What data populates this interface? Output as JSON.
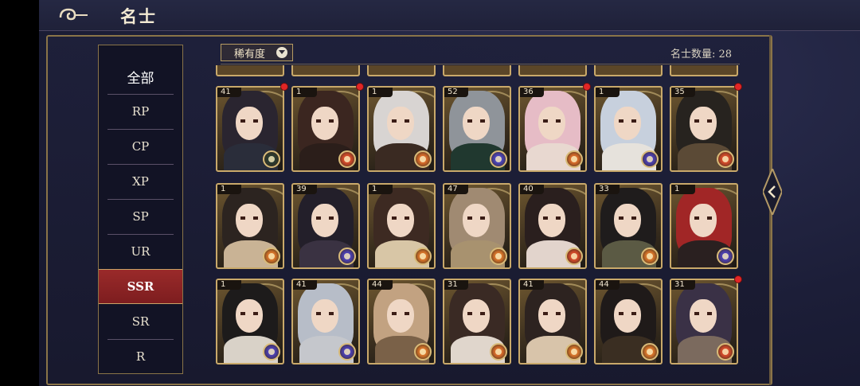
{
  "header": {
    "title": "名士"
  },
  "sidebar": {
    "items": [
      {
        "label": "全部"
      },
      {
        "label": "RP"
      },
      {
        "label": "CP"
      },
      {
        "label": "XP"
      },
      {
        "label": "SP"
      },
      {
        "label": "UR"
      },
      {
        "label": "SSR",
        "selected": true
      },
      {
        "label": "SR"
      },
      {
        "label": "R"
      }
    ]
  },
  "filter": {
    "label": "稀有度",
    "icon": "chevron-down-icon"
  },
  "count": {
    "text": "名士数量: 28"
  },
  "cards": [
    {
      "level": "41",
      "hair": "#2a2530",
      "body": "#2a2d3a",
      "badge": "#2b3a2f",
      "dot": true
    },
    {
      "level": "1",
      "hair": "#3b2620",
      "body": "#2b1e1a",
      "badge": "#d04a2a",
      "dot": true
    },
    {
      "level": "1",
      "hair": "#d8d4d2",
      "body": "#3a2a22",
      "badge": "#d46a2a",
      "dot": false
    },
    {
      "level": "52",
      "hair": "#8f949a",
      "body": "#20382f",
      "badge": "#4a43b8",
      "dot": false
    },
    {
      "level": "36",
      "hair": "#e6bcc6",
      "body": "#e8d8d0",
      "badge": "#d46a2a",
      "dot": true
    },
    {
      "level": "1",
      "hair": "#c7d0dd",
      "body": "#e6e2dc",
      "badge": "#4b3fae",
      "dot": false
    },
    {
      "level": "35",
      "hair": "#27231f",
      "body": "#5b4a36",
      "badge": "#d04a2a",
      "dot": true
    },
    {
      "level": "1",
      "hair": "#2c2420",
      "body": "#c9b395",
      "badge": "#d4732a",
      "dot": false
    },
    {
      "level": "39",
      "hair": "#231f2a",
      "body": "#3a3242",
      "badge": "#4b3fae",
      "dot": false
    },
    {
      "level": "1",
      "hair": "#3d2a22",
      "body": "#d8c6a6",
      "badge": "#d4732a",
      "dot": false
    },
    {
      "level": "47",
      "hair": "#a08a72",
      "body": "#a8926f",
      "badge": "#d4732a",
      "dot": false
    },
    {
      "level": "40",
      "hair": "#2a1f1e",
      "body": "#e2d4cc",
      "badge": "#d04a2a",
      "dot": false
    },
    {
      "level": "33",
      "hair": "#1f1c1c",
      "body": "#5b5a44",
      "badge": "#d4732a",
      "dot": false
    },
    {
      "level": "1",
      "hair": "#a12626",
      "body": "#2a2020",
      "badge": "#4b3fae",
      "dot": false
    },
    {
      "level": "1",
      "hair": "#1d1b1b",
      "body": "#d9d2c8",
      "badge": "#4b3fae",
      "dot": false
    },
    {
      "level": "41",
      "hair": "#b7bdc8",
      "body": "#c5c7cc",
      "badge": "#4b3fae",
      "dot": false
    },
    {
      "level": "44",
      "hair": "#c2a281",
      "body": "#7a6148",
      "badge": "#d4732a",
      "dot": false
    },
    {
      "level": "31",
      "hair": "#3a2a24",
      "body": "#e0d6cc",
      "badge": "#d46a2a",
      "dot": false
    },
    {
      "level": "41",
      "hair": "#2d2320",
      "body": "#d8c4aa",
      "badge": "#d4732a",
      "dot": false
    },
    {
      "level": "44",
      "hair": "#1f1a19",
      "body": "#3a2e22",
      "badge": "#d4732a",
      "dot": false
    },
    {
      "level": "31",
      "hair": "#3a3146",
      "body": "#7b6a5e",
      "badge": "#d04a2a",
      "dot": true
    }
  ]
}
